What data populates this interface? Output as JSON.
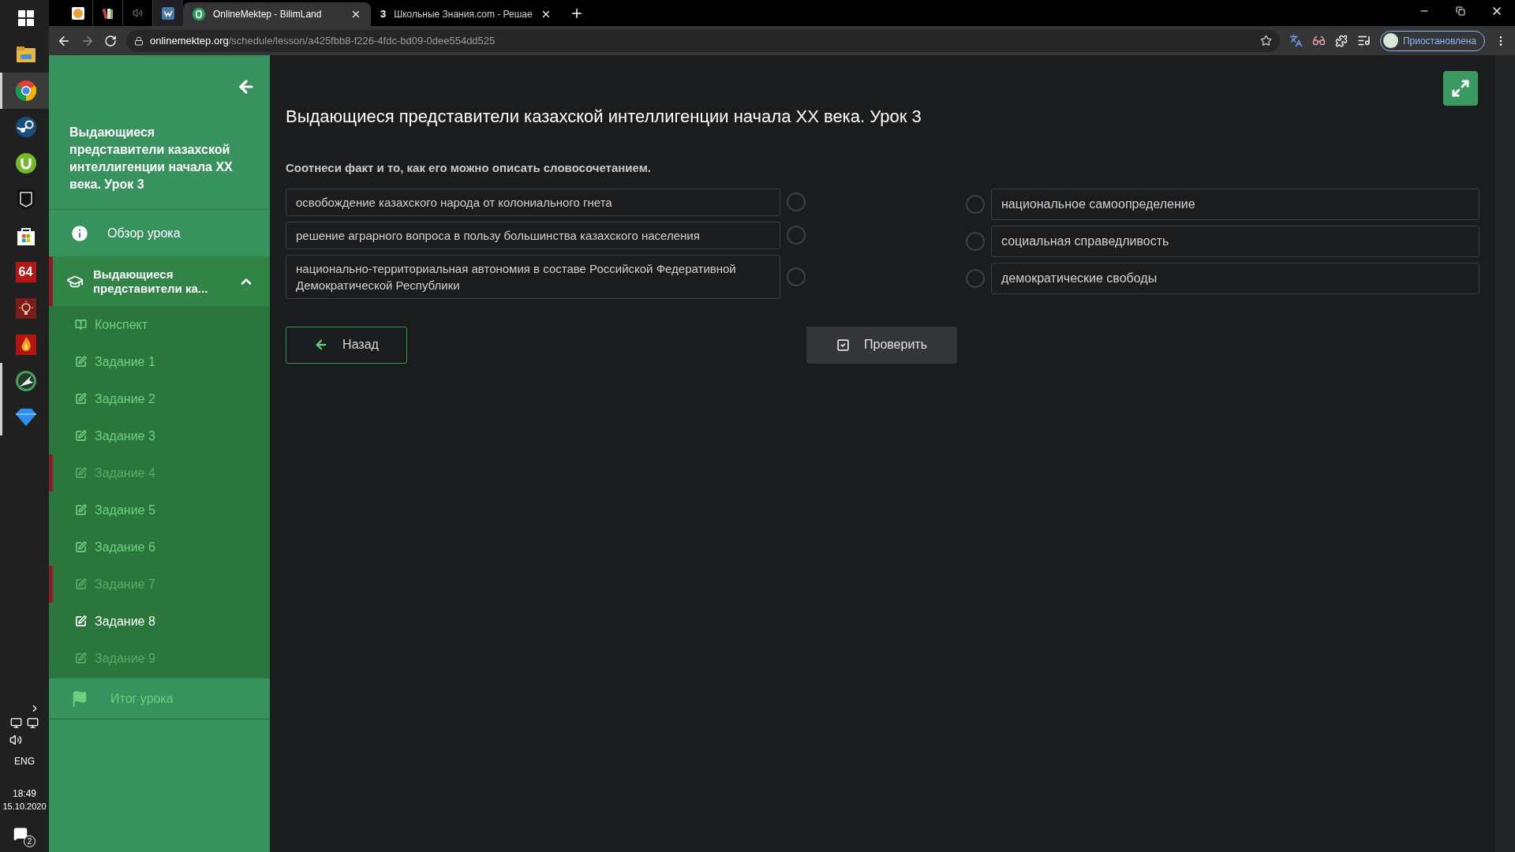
{
  "taskbar": {
    "apps": [
      {
        "kind": "windows",
        "open": false
      },
      {
        "kind": "explorer",
        "open": false
      },
      {
        "kind": "chrome",
        "open": true
      },
      {
        "kind": "steam",
        "open": false
      },
      {
        "kind": "torrent",
        "open": false
      },
      {
        "kind": "epic",
        "open": false
      },
      {
        "kind": "store",
        "open": false
      },
      {
        "kind": "aida",
        "open": false,
        "label": "64"
      },
      {
        "kind": "bulb",
        "open": false
      },
      {
        "kind": "flame",
        "open": false
      },
      {
        "kind": "globe",
        "open": true
      },
      {
        "kind": "diamond",
        "open": true
      }
    ],
    "tray": {
      "language": "ENG",
      "time": "18:49",
      "date": "15.10.2020",
      "notifications": "2"
    }
  },
  "browser": {
    "pinned_tabs": [
      {
        "kind": "orange"
      },
      {
        "kind": "books"
      },
      {
        "kind": "speaker"
      },
      {
        "kind": "vk"
      }
    ],
    "tabs": [
      {
        "title": "OnlineMektep - BilimLand",
        "selected": true,
        "kind": "bilimland"
      },
      {
        "title": "Школьные Знания.com - Решае",
        "selected": false,
        "kind": "znania",
        "favicon_text": "3"
      }
    ],
    "address": {
      "host": "onlinemektep.org",
      "path": "/schedule/lesson/a425fbb8-f226-4fdc-bd09-0dee554dd525"
    },
    "profile": {
      "label": "Приостановлена"
    }
  },
  "sidebar": {
    "title": "Выдающиеся представители казахской интеллигенции начала XX века. Урок 3",
    "overview": "Обзор урока",
    "section": {
      "title": "Выдающиеся представители ка...",
      "expanded": true,
      "items": [
        {
          "kind": "notes",
          "label": "Конспект",
          "completed": true,
          "wrong": false,
          "selected": false
        },
        {
          "kind": "task",
          "label": "Задание 1",
          "completed": true,
          "wrong": false,
          "selected": false
        },
        {
          "kind": "task",
          "label": "Задание 2",
          "completed": true,
          "wrong": false,
          "selected": false
        },
        {
          "kind": "task",
          "label": "Задание 3",
          "completed": true,
          "wrong": false,
          "selected": false
        },
        {
          "kind": "task",
          "label": "Задание 4",
          "completed": false,
          "wrong": true,
          "selected": false
        },
        {
          "kind": "task",
          "label": "Задание 5",
          "completed": true,
          "wrong": false,
          "selected": false
        },
        {
          "kind": "task",
          "label": "Задание 6",
          "completed": true,
          "wrong": false,
          "selected": false
        },
        {
          "kind": "task",
          "label": "Задание 7",
          "completed": false,
          "wrong": true,
          "selected": false
        },
        {
          "kind": "task",
          "label": "Задание 8",
          "completed": true,
          "wrong": false,
          "selected": true
        },
        {
          "kind": "task",
          "label": "Задание 9",
          "completed": false,
          "wrong": false,
          "selected": false
        }
      ]
    },
    "summary": "Итог урока"
  },
  "lesson": {
    "title": "Выдающиеся представители казахской интеллигенции начала XX века. Урок 3",
    "instruction": "Соотнеси факт и то, как его можно описать словосочетанием.",
    "facts": [
      "освобождение казахского народа от колониального гнета",
      "решение аграрного вопроса в пользу большинства казахского населения",
      "национально-территориальная автономия в составе Российской Федеративной Демократической Республики"
    ],
    "phrases": [
      "национальное самоопределение",
      "социальная справедливость",
      "демократические свободы"
    ],
    "back_button": "Назад",
    "check_button": "Проверить"
  }
}
